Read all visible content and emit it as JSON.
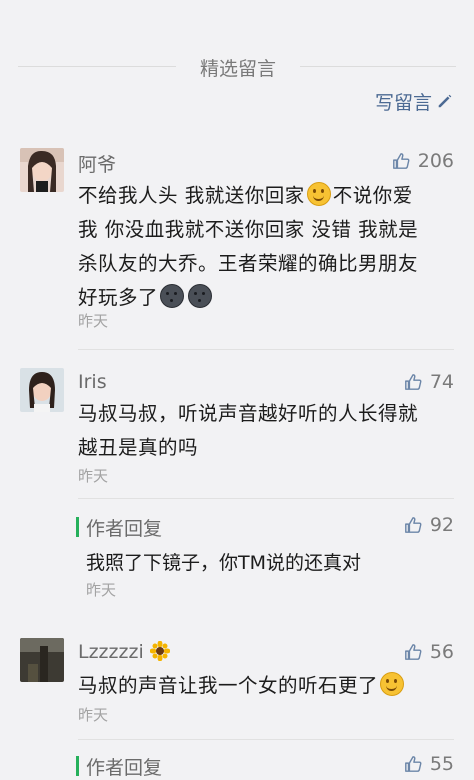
{
  "section": {
    "title": "精选留言",
    "write_label": "写留言"
  },
  "comments": [
    {
      "nick": "阿爷",
      "likes": "206",
      "lines": [
        [
          "不给我人头 我就送你回家",
          "不说你爱"
        ],
        [
          "我 你没血我就不送你回家 没错 我就是"
        ],
        [
          "杀队友的大乔。王者荣耀的确比男朋友"
        ],
        [
          "好玩多了"
        ]
      ],
      "time": "昨天"
    },
    {
      "nick": "Iris",
      "likes": "74",
      "lines": [
        [
          "马叔马叔，听说声音越好听的人长得就"
        ],
        [
          "越丑是真的吗"
        ]
      ],
      "time": "昨天",
      "reply": {
        "label": "作者回复",
        "likes": "92",
        "text": "我照了下镜子，你TM说的还真对",
        "time": "昨天"
      }
    },
    {
      "nick": "Lzzzzzi",
      "likes": "56",
      "lines": [
        [
          "马叔的声音让我一个女的听石更了"
        ]
      ],
      "time": "昨天",
      "reply": {
        "label": "作者回复",
        "likes": "55"
      }
    }
  ],
  "colors": {
    "accent_link": "#4c6a93",
    "reply_bar": "#26b05b",
    "background": "#f2f2f4"
  },
  "icons": {
    "write": "pencil-icon",
    "like": "thumbs-up-icon",
    "emoji_smile": "smile-emoji-icon",
    "emoji_moon": "dark-moon-emoji-icon",
    "sunflower": "sunflower-icon"
  }
}
